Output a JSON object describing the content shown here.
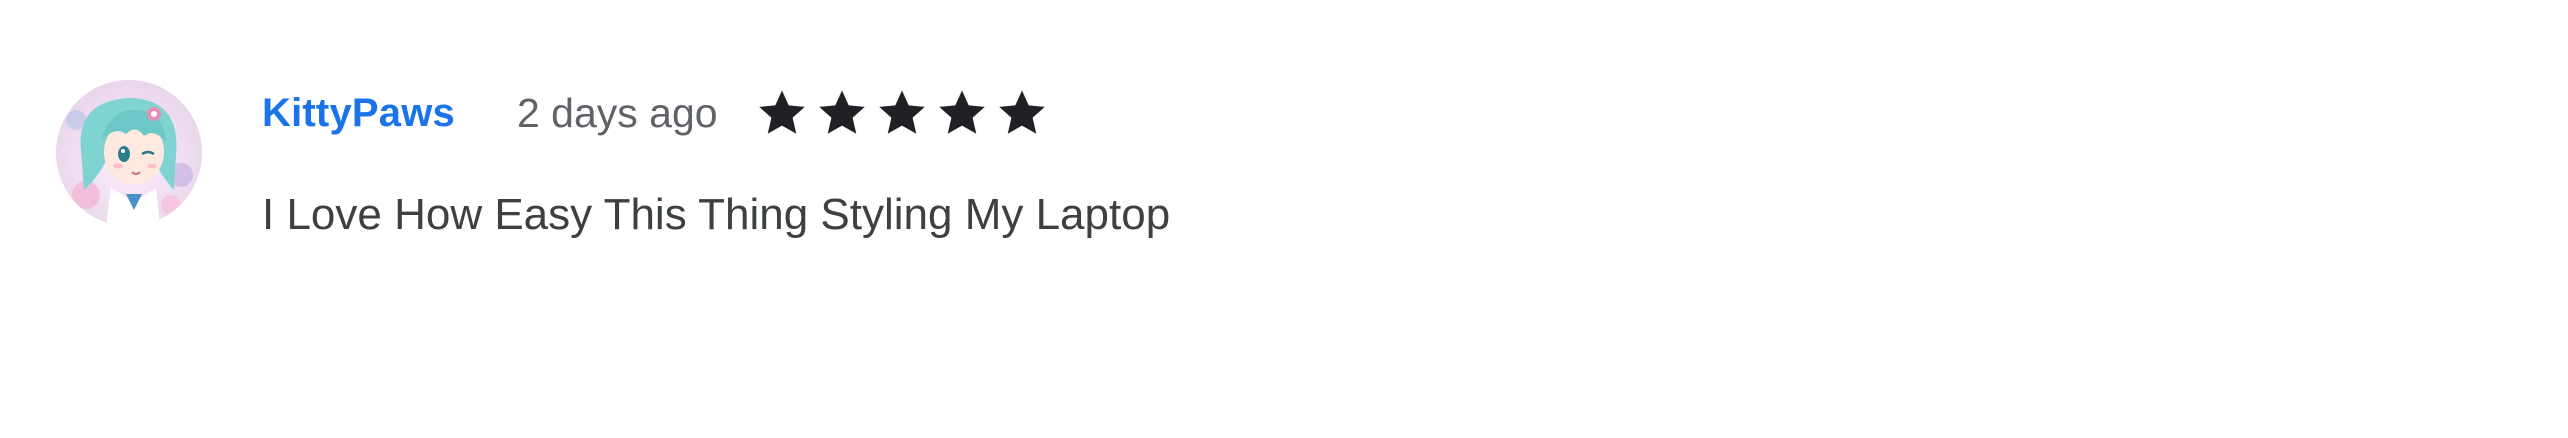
{
  "review": {
    "author": "KittyPaws",
    "date": "2 days ago",
    "rating": 5,
    "rating_max": 5,
    "text": "I Love How Easy This Thing Styling My Laptop"
  },
  "colors": {
    "author_link": "#1a73e8",
    "date_text": "#5f6368",
    "star_filled": "#202124",
    "body_text": "#3c4043"
  },
  "icons": {
    "avatar": "anime-avatar-image",
    "star": "star-icon"
  }
}
